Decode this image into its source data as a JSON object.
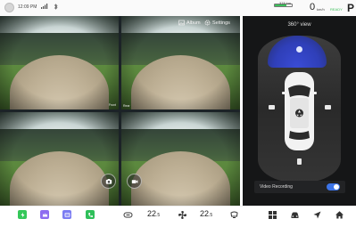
{
  "status_bar": {
    "time": "12:09 PM",
    "range": "378 km",
    "battery_fraction": 0.7,
    "speed_value": "0",
    "speed_unit": "km/h",
    "ready_text": "READY",
    "gear": "P"
  },
  "camera_grid": {
    "top_buttons": [
      {
        "label": "Album",
        "icon": "album-icon"
      },
      {
        "label": "Settings",
        "icon": "gear-icon"
      }
    ],
    "views": [
      {
        "name": "front",
        "label": "Front"
      },
      {
        "name": "rear",
        "label": "Rear"
      },
      {
        "name": "left",
        "label": ""
      },
      {
        "name": "right",
        "label": ""
      }
    ],
    "action_buttons": [
      {
        "name": "camera-capture",
        "icon": "camera-icon"
      },
      {
        "name": "video-capture",
        "icon": "video-icon"
      }
    ]
  },
  "panel_360": {
    "title": "360° view",
    "selected_zone": "front",
    "accent_color": "#3a4cd6",
    "video_recording": {
      "label": "Video Recording",
      "enabled": true
    }
  },
  "dock": {
    "apps": [
      {
        "name": "app-green",
        "color": "#34c759",
        "icon": "bolt-icon"
      },
      {
        "name": "app-purple",
        "color": "#8e6cf0",
        "icon": "crown-icon"
      },
      {
        "name": "app-violet",
        "color": "#7b7cf2",
        "icon": "grid-icon"
      },
      {
        "name": "app-phone",
        "color": "#2fbf5a",
        "icon": "phone-icon"
      }
    ],
    "left_temp": "22",
    "left_temp_unit": ".5",
    "right_temp": "22",
    "right_temp_unit": ".5",
    "right_icons": [
      "apps-grid-icon",
      "car-icon",
      "navigation-icon",
      "home-icon"
    ]
  }
}
